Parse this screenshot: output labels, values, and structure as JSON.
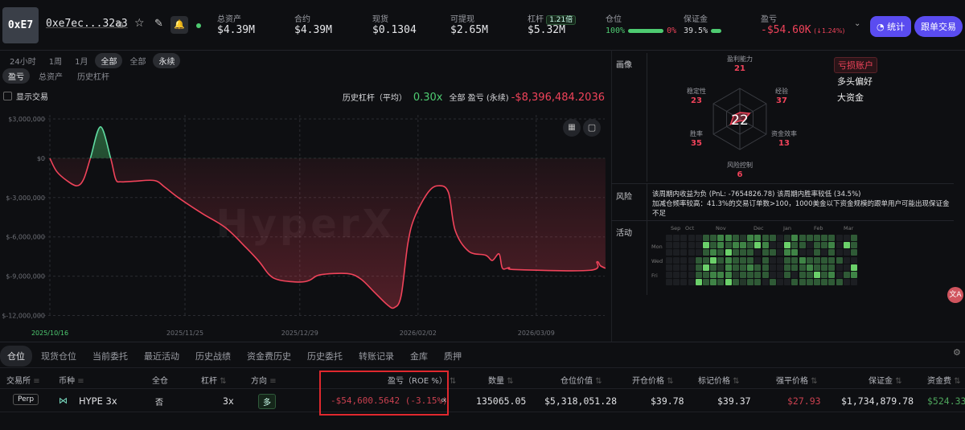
{
  "header": {
    "avatar": "0xE7",
    "address": "0xe7ec...32a3",
    "stats": [
      {
        "label": "总资产",
        "value": "$4.39M"
      },
      {
        "label": "合约",
        "value": "$4.39M"
      },
      {
        "label": "现货",
        "value": "$0.1304"
      },
      {
        "label": "可提现",
        "value": "$2.65M"
      }
    ],
    "leverage": {
      "label": "杠杆",
      "badge": "1.21倍",
      "value": "$5.32M"
    },
    "position": {
      "label": "仓位",
      "long": "100%",
      "short": "0%",
      "long_fraction": 1.0
    },
    "margin": {
      "label": "保证金",
      "value": "39.5%",
      "fraction": 0.395
    },
    "pnl": {
      "label": "盈亏",
      "value": "-$54.60K",
      "change": "(↓1.24%)"
    },
    "stats_button": "统计",
    "copy_button": "跟单交易"
  },
  "filters": {
    "ranges": [
      "24小时",
      "1周",
      "1月",
      "全部"
    ],
    "active_range": "全部",
    "types": [
      "全部",
      "永续"
    ],
    "active_type": "永续",
    "metrics": [
      "盈亏",
      "总资产",
      "历史杠杆"
    ],
    "active_metric": "盈亏",
    "show_trades": "显示交易"
  },
  "summary": {
    "avg_leverage_label": "历史杠杆（平均）",
    "avg_leverage": "0.30x",
    "pnl_label": "全部 盈亏 (永续)",
    "pnl": "-$8,396,484.2036"
  },
  "chart_data": {
    "type": "area",
    "title": "",
    "xlabel": "",
    "ylabel": "",
    "watermark": "HyperX",
    "x_unit": "days since 2025/10/16",
    "ylim": [
      -12,
      3
    ],
    "y_unit": "$M",
    "yticks": [
      "$3,000,000",
      "$0",
      "$-3,000,000",
      "$-6,000,000",
      "$-9,000,000",
      "$-12,000,000"
    ],
    "ytick_values": [
      3,
      0,
      -3,
      -6,
      -9,
      -12
    ],
    "xticks": [
      "2025/10/16",
      "2025/11/25",
      "2025/12/29",
      "2026/02/02",
      "2026/03/09"
    ],
    "xtick_values": [
      0,
      40,
      74,
      109,
      144
    ],
    "grid": true,
    "points": [
      [
        0,
        0
      ],
      [
        2,
        -1.0
      ],
      [
        5,
        -1.7
      ],
      [
        8,
        -2.1
      ],
      [
        10,
        -1.6
      ],
      [
        12,
        0
      ],
      [
        15,
        2.4
      ],
      [
        18,
        0
      ],
      [
        19.5,
        -1.6
      ],
      [
        21,
        -1.8
      ],
      [
        25,
        -1.75
      ],
      [
        31,
        -1.7
      ],
      [
        34,
        -2.2
      ],
      [
        38,
        -3.0
      ],
      [
        45,
        -4.2
      ],
      [
        52,
        -5.3
      ],
      [
        58,
        -6.8
      ],
      [
        62,
        -7.9
      ],
      [
        65,
        -8.9
      ],
      [
        68,
        -9.3
      ],
      [
        74,
        -9.45
      ],
      [
        77,
        -9.3
      ],
      [
        80,
        -8.9
      ],
      [
        88,
        -8.8
      ],
      [
        92,
        -9.2
      ],
      [
        96,
        -10.2
      ],
      [
        100,
        -11.2
      ],
      [
        102,
        -11.4
      ],
      [
        104,
        -10.5
      ],
      [
        106,
        -6.5
      ],
      [
        108,
        -4.5
      ],
      [
        112,
        -2.6
      ],
      [
        115,
        -2.1
      ],
      [
        118,
        -2.6
      ],
      [
        120,
        -5.5
      ],
      [
        124,
        -7.1
      ],
      [
        129,
        -7.4
      ],
      [
        131,
        -7.8
      ],
      [
        133,
        -7.3
      ],
      [
        134,
        -8.4
      ],
      [
        136,
        -8.35
      ],
      [
        138,
        -8.5
      ],
      [
        160,
        -8.55
      ],
      [
        162,
        -7.9
      ],
      [
        163,
        -8.2
      ],
      [
        164.5,
        -8.4
      ]
    ]
  },
  "profile": {
    "label": "画像",
    "score": "22",
    "axes": [
      {
        "name": "盈利能力",
        "value": 21
      },
      {
        "name": "经验",
        "value": 37
      },
      {
        "name": "资金效率",
        "value": 13
      },
      {
        "name": "风险控制",
        "value": 6
      },
      {
        "name": "胜率",
        "value": 35
      },
      {
        "name": "稳定性",
        "value": 23
      }
    ],
    "tags": [
      "亏损账户",
      "多头偏好",
      "大资金"
    ]
  },
  "risk": {
    "label": "风险",
    "line1": "该周期内收益为负 (PnL: -7654826.78)    该周期内胜率较低 (34.5%)",
    "line2": "加减仓频率较高：41.3%的交易订单数>100，1000美金以下资金规模的跟单用户可能出现保证金不足"
  },
  "activity": {
    "label": "活动",
    "months": [
      "Sep",
      "Oct",
      "Nov",
      "Dec",
      "Jan",
      "Feb",
      "Mar"
    ],
    "days": [
      "Mon",
      "Wed",
      "Fri"
    ],
    "grid": [
      "00000223321332201322222002",
      "00000423233243004220223042",
      "00000232422202203300202002",
      "00002242322202002232222200",
      "00002421322322002223222004",
      "00002233312222002022423023",
      "00004232421220200222222200"
    ]
  },
  "tabs": [
    "仓位",
    "现货仓位",
    "当前委托",
    "最近活动",
    "历史战绩",
    "资金费历史",
    "历史委托",
    "转账记录",
    "金库",
    "质押"
  ],
  "table": {
    "headers": [
      "交易所",
      "币种",
      "全仓",
      "杠杆",
      "方向",
      "盈亏（ROE %）",
      "数量",
      "仓位价值",
      "开仓价格",
      "标记价格",
      "强平价格",
      "保证金",
      "资金费"
    ],
    "rows": [
      {
        "exchange": "Perp",
        "coin": "HYPE 3x",
        "cross": "否",
        "leverage": "3x",
        "side": "多",
        "pnl": "-$54,600.5642 (-3.15%)",
        "size": "135065.05",
        "value": "$5,318,051.28",
        "entry": "$39.78",
        "mark": "$39.37",
        "liq": "$27.93",
        "margin": "$1,734,879.78",
        "funding": "$524.33"
      }
    ]
  }
}
